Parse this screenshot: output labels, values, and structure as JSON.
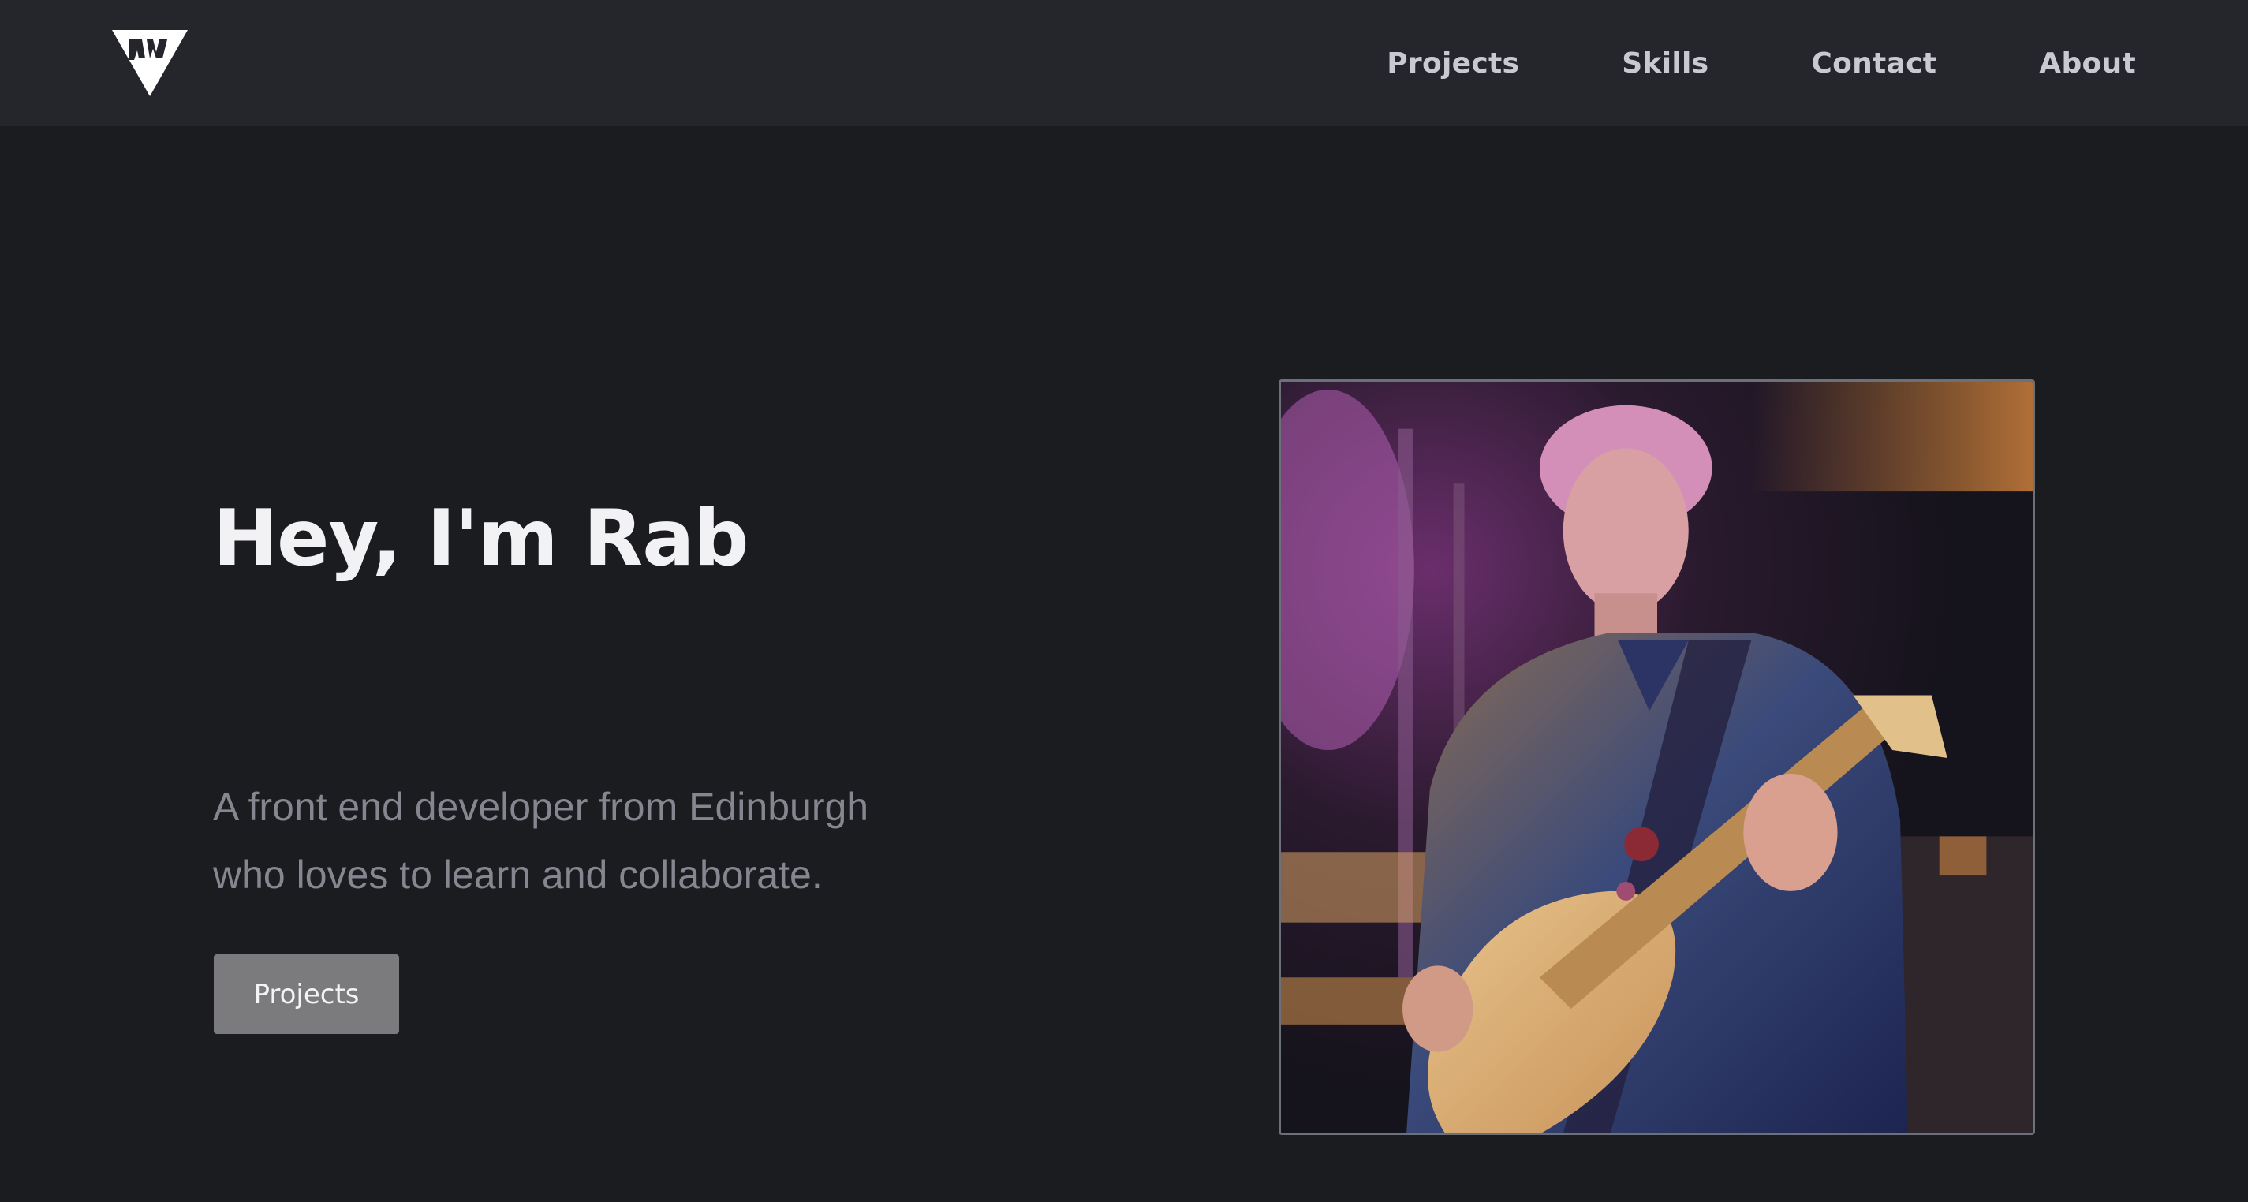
{
  "header": {
    "logo": "rw-triangle-logo",
    "nav": [
      {
        "label": "Projects"
      },
      {
        "label": "Skills"
      },
      {
        "label": "Contact"
      },
      {
        "label": "About"
      }
    ]
  },
  "hero": {
    "title": "Hey, I'm Rab",
    "subtitle_line1": "A front end developer from Edinburgh",
    "subtitle_line2": "who loves to learn and collaborate.",
    "button_label": "Projects",
    "photo": "guitarist-on-stage-photo"
  },
  "colors": {
    "background": "#1b1c20",
    "header": "#25262b",
    "nav_text": "#c9cad1",
    "title": "#f2f2f5",
    "subtitle": "#85868f",
    "button": "#7b7b7d"
  }
}
